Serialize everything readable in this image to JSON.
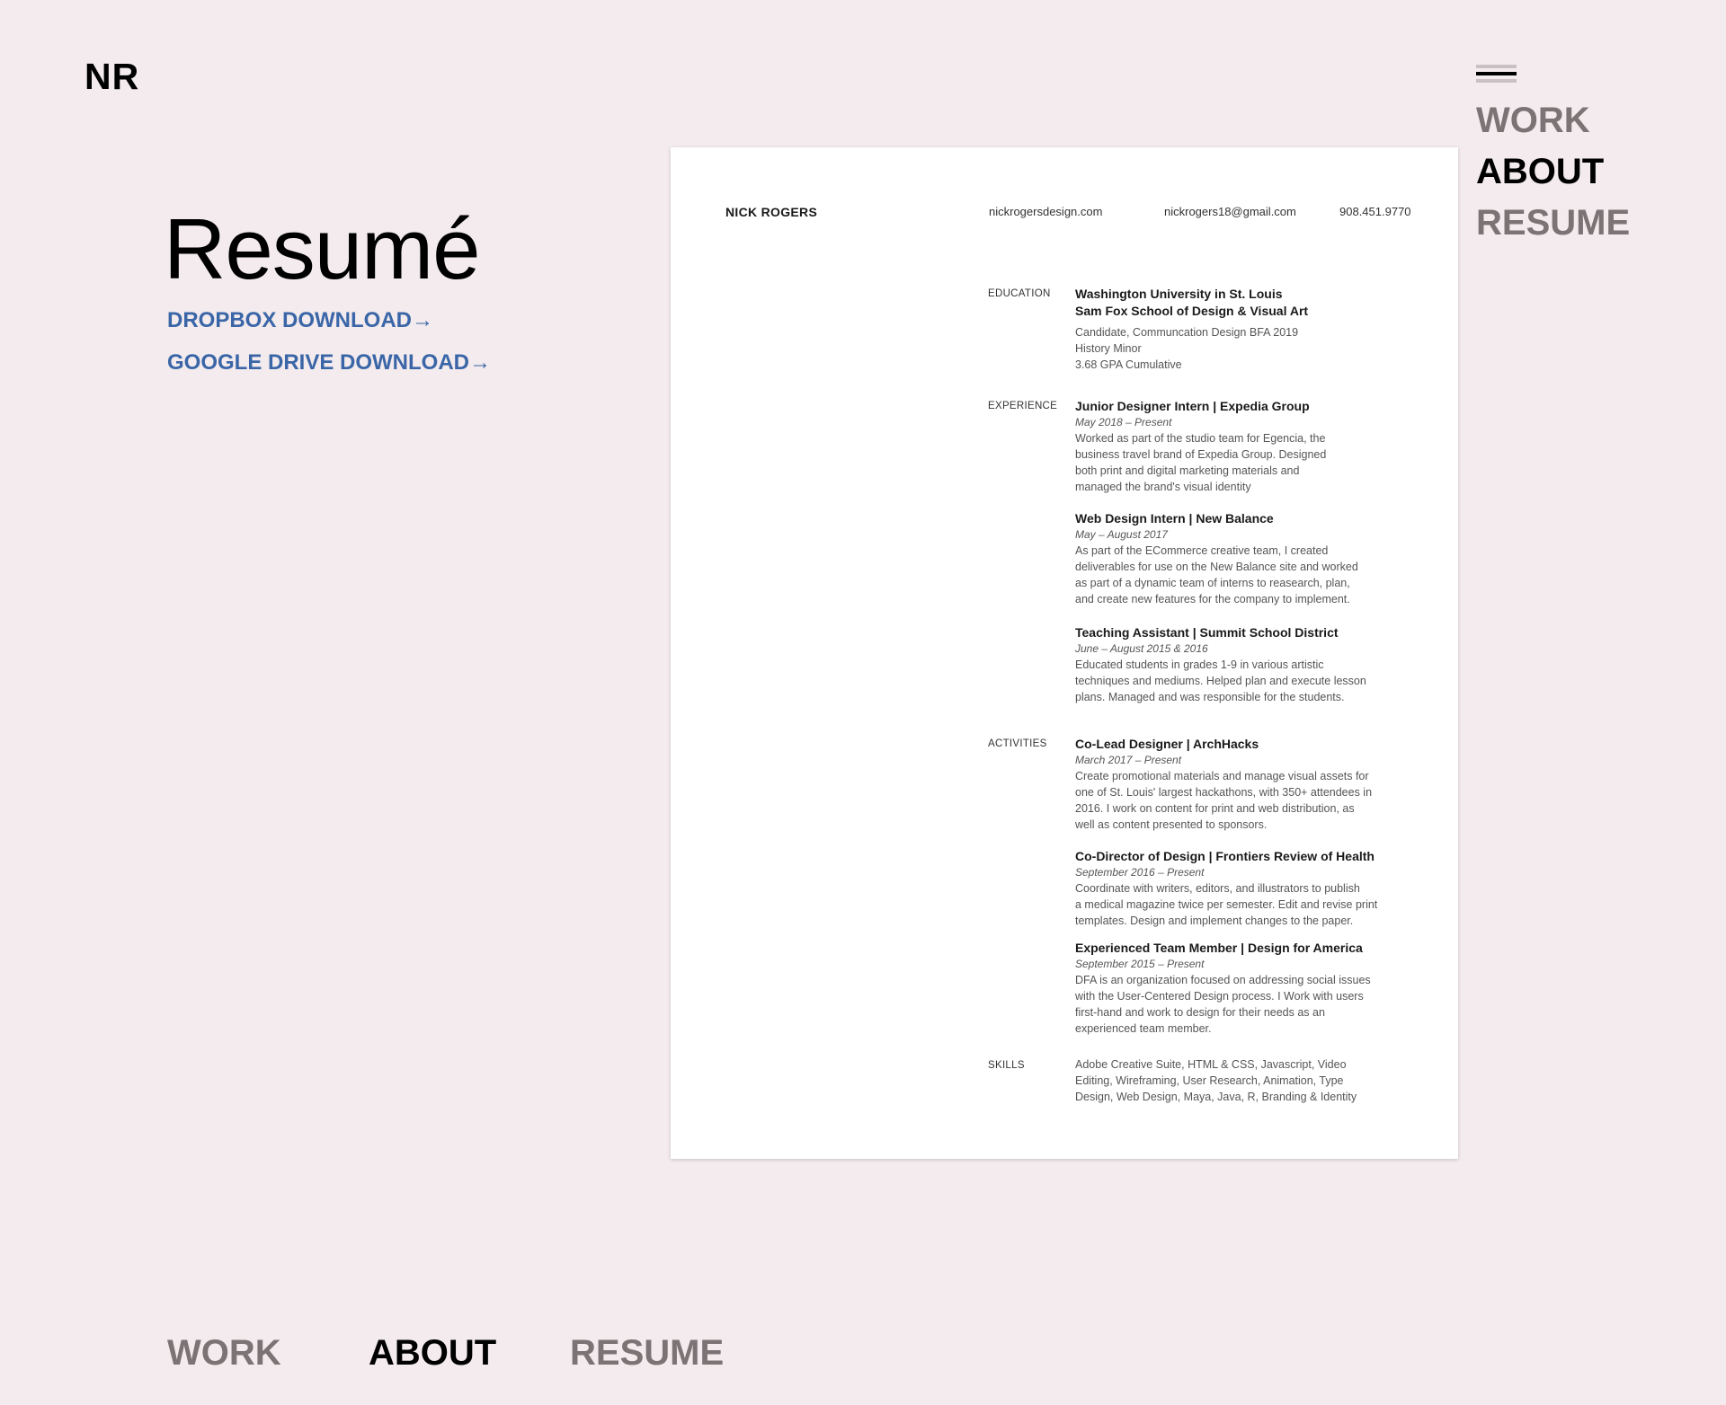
{
  "logo": "NR",
  "nav": {
    "work": "WORK",
    "about": "ABOUT",
    "resume": "RESUME"
  },
  "page": {
    "title": "Resumé",
    "dropbox_link": "DROPBOX DOWNLOAD→",
    "gdrive_link": "GOOGLE DRIVE DOWNLOAD→"
  },
  "resume": {
    "name": "NICK ROGERS",
    "website": "nickrogersdesign.com",
    "email": "nickrogers18@gmail.com",
    "phone": "908.451.9770",
    "education": {
      "label": "EDUCATION",
      "school": "Washington University in St. Louis",
      "school_sub": "Sam Fox School of Design & Visual Art",
      "line1": "Candidate, Communcation Design BFA 2019",
      "line2": "History Minor",
      "line3": "3.68 GPA Cumulative"
    },
    "experience": {
      "label": "EXPERIENCE",
      "items": [
        {
          "title": "Junior Designer Intern | Expedia Group",
          "date": "May 2018 – Present",
          "lines": [
            "Worked as part of the studio team for Egencia, the",
            "business travel brand of Expedia Group. Designed",
            "both print and digital marketing materials and",
            "managed the brand's visual identity"
          ]
        },
        {
          "title": "Web Design Intern | New Balance",
          "date": "May – August 2017",
          "lines": [
            "As part of the ECommerce creative team, I created",
            "deliverables for use on the New Balance site and worked",
            "as part of a dynamic team of interns to reasearch, plan,",
            "and create new features for the company to implement."
          ]
        },
        {
          "title": "Teaching Assistant | Summit School District",
          "date": "June – August 2015 & 2016",
          "lines": [
            "Educated students in grades 1-9 in various artistic",
            "techniques and mediums. Helped plan and execute lesson",
            "plans. Managed and was responsible for the students."
          ]
        }
      ]
    },
    "activities": {
      "label": "ACTIVITIES",
      "items": [
        {
          "title": "Co-Lead Designer | ArchHacks",
          "date": "March 2017 – Present",
          "lines": [
            "Create promotional materials and manage visual assets for",
            "one of St. Louis' largest hackathons, with 350+ attendees in",
            "2016. I work on content for print and web distribution, as",
            "well as content presented to sponsors."
          ]
        },
        {
          "title": "Co-Director of Design | Frontiers Review of Health",
          "date": "September 2016 – Present",
          "lines": [
            "Coordinate with writers, editors, and illustrators to publish",
            "a medical magazine twice per semester. Edit and revise print",
            "templates. Design and implement changes to the paper."
          ]
        },
        {
          "title": "Experienced Team Member | Design for America",
          "date": "September 2015 – Present",
          "lines": [
            "DFA is an organization focused on addressing social issues",
            "with the User-Centered Design process. I Work with users",
            "first-hand and work to design for their needs as an",
            "experienced team member."
          ]
        }
      ]
    },
    "skills": {
      "label": "SKILLS",
      "lines": [
        "Adobe Creative Suite, HTML & CSS, Javascript, Video",
        "Editing, Wireframing, User Research, Animation, Type",
        "Design, Web Design, Maya, Java, R, Branding & Identity"
      ]
    }
  }
}
